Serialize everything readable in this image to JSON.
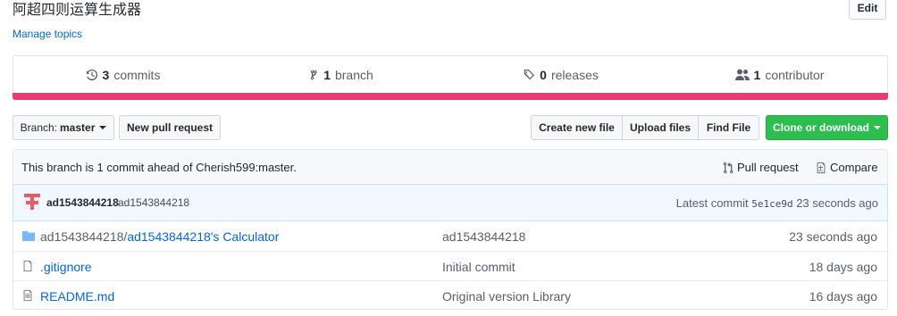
{
  "repo": {
    "description": "阿超四则运算生成器",
    "edit_label": "Edit",
    "manage_topics": "Manage topics"
  },
  "summary": {
    "commits": {
      "count": "3",
      "label": "commits"
    },
    "branches": {
      "count": "1",
      "label": "branch"
    },
    "releases": {
      "count": "0",
      "label": "releases"
    },
    "contributors": {
      "count": "1",
      "label": "contributor"
    },
    "language_bar_color": "#e83d74"
  },
  "toolbar": {
    "branch_prefix": "Branch:",
    "branch_name": "master",
    "new_pull_request": "New pull request",
    "create_new_file": "Create new file",
    "upload_files": "Upload files",
    "find_file": "Find File",
    "clone_or_download": "Clone or download",
    "clone_color": "#2cbe4e"
  },
  "branch_status": {
    "text": "This branch is 1 commit ahead of Cherish599:master.",
    "pull_request": "Pull request",
    "compare": "Compare"
  },
  "latest_commit": {
    "author": "ad1543844218",
    "message": "ad1543844218",
    "prefix": "Latest commit",
    "sha": "5e1ce9d",
    "age": "23 seconds ago"
  },
  "files": [
    {
      "type": "folder",
      "path_prefix": "ad1543844218/",
      "name": "ad1543844218's Calculator",
      "message": "ad1543844218",
      "age": "23 seconds ago"
    },
    {
      "type": "file",
      "path_prefix": "",
      "name": ".gitignore",
      "message": "Initial commit",
      "age": "18 days ago"
    },
    {
      "type": "file",
      "path_prefix": "",
      "name": "README.md",
      "message": "Original version Library",
      "age": "16 days ago"
    }
  ]
}
